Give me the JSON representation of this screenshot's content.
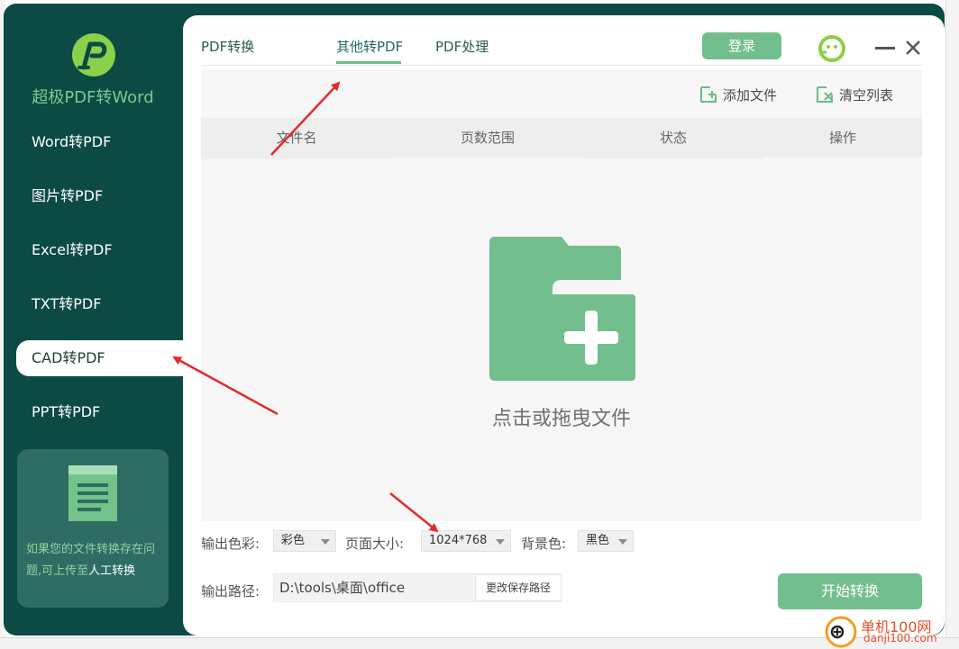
{
  "app": {
    "brand": "超极PDF转Word",
    "colors": {
      "sidebar": "#0c4a44",
      "accent": "#73be8d",
      "promo": "#2e6d63"
    }
  },
  "sidebar": {
    "items": [
      {
        "label": "Word转PDF"
      },
      {
        "label": "图片转PDF"
      },
      {
        "label": "Excel转PDF"
      },
      {
        "label": "TXT转PDF"
      },
      {
        "label": "CAD转PDF",
        "active": true
      },
      {
        "label": "PPT转PDF"
      }
    ],
    "promo": {
      "text": "如果您的文件转换存在问题,可上传至",
      "highlight": "人工转换"
    }
  },
  "tabs": [
    {
      "label": "PDF转换"
    },
    {
      "label": "其他转PDF",
      "active": true
    },
    {
      "label": "PDF处理"
    }
  ],
  "header": {
    "login_label": "登录"
  },
  "toolbar": {
    "add_label": "添加文件",
    "clear_label": "清空列表"
  },
  "table": {
    "columns": [
      "文件名",
      "页数范围",
      "状态",
      "操作"
    ]
  },
  "dropzone": {
    "text": "点击或拖曳文件"
  },
  "options": {
    "color_label": "输出色彩:",
    "color_value": "彩色",
    "size_label": "页面大小:",
    "size_value": "1024*768",
    "bg_label": "背景色:",
    "bg_value": "黑色"
  },
  "output": {
    "path_label": "输出路径:",
    "path_value": "D:\\tools\\桌面\\office",
    "change_label": "更改保存路径",
    "start_label": "开始转换"
  },
  "watermark": {
    "text": "单机100网",
    "sub": "danji100.com"
  }
}
